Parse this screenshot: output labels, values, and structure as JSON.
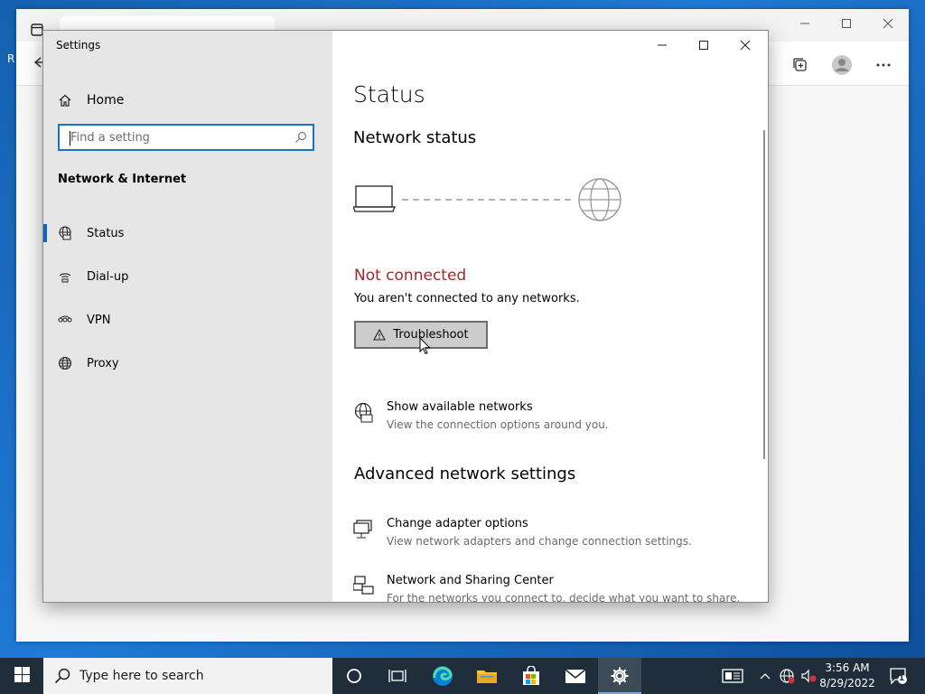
{
  "settings": {
    "window_title": "Settings",
    "sidebar": {
      "home_label": "Home",
      "search_placeholder": "Find a setting",
      "section_title": "Network & Internet",
      "items": [
        {
          "label": "Status",
          "icon": "status-globe-icon",
          "active": true
        },
        {
          "label": "Dial-up",
          "icon": "dialup-icon",
          "active": false
        },
        {
          "label": "VPN",
          "icon": "vpn-icon",
          "active": false
        },
        {
          "label": "Proxy",
          "icon": "proxy-globe-icon",
          "active": false
        }
      ]
    },
    "main": {
      "title": "Status",
      "network_status_heading": "Network status",
      "connection_state": "Not connected",
      "connection_desc": "You aren't connected to any networks.",
      "troubleshoot_label": "Troubleshoot",
      "show_networks": {
        "title": "Show available networks",
        "desc": "View the connection options around you."
      },
      "advanced_heading": "Advanced network settings",
      "adapter_options": {
        "title": "Change adapter options",
        "desc": "View network adapters and change connection settings."
      },
      "sharing_center": {
        "title": "Network and Sharing Center",
        "desc": "For the networks you connect to, decide what you want to share."
      }
    },
    "colors": {
      "accent": "#0a66c2",
      "error": "#a4262c"
    }
  },
  "taskbar": {
    "search_placeholder": "Type here to search",
    "time": "3:56 AM",
    "date": "8/29/2022",
    "notification_count": "1"
  }
}
